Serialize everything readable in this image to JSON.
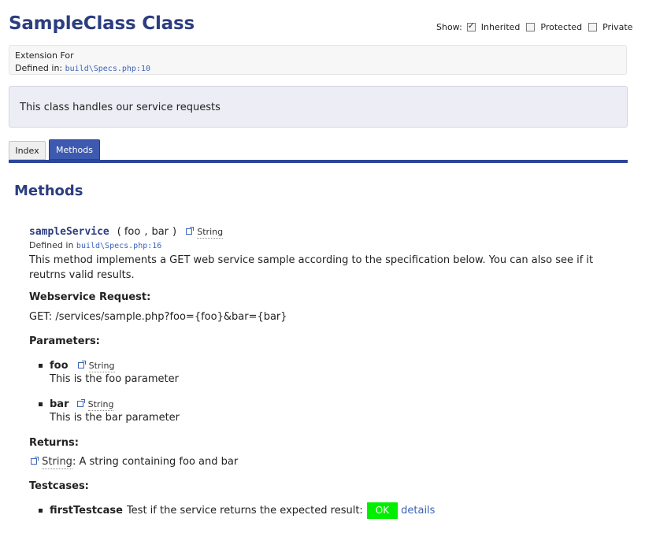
{
  "header": {
    "title": "SampleClass Class",
    "show_label": "Show:",
    "options": [
      {
        "label": "Inherited",
        "checked": true
      },
      {
        "label": "Protected",
        "checked": false
      },
      {
        "label": "Private",
        "checked": false
      }
    ]
  },
  "ext": {
    "line1": "Extension For",
    "defined_label": "Defined in:",
    "defined_path": "build\\Specs.php:10"
  },
  "description": "This class handles our service requests",
  "tabs": {
    "index": "Index",
    "methods": "Methods"
  },
  "section_title": "Methods",
  "method": {
    "name": "sampleService",
    "open": "(",
    "p1": "foo",
    "comma": ",",
    "p2": "bar",
    "close": ")",
    "return_type": "String",
    "defined_label": "Defined in",
    "defined_path": "build\\Specs.php:16",
    "desc_line1": "This method implements a GET web service sample according to the specification below. You can also see if it",
    "desc_line2": "reutrns valid results.",
    "ws_heading": "Webservice Request:",
    "ws_value": "GET: /services/sample.php?foo={foo}&bar={bar}",
    "params_heading": "Parameters:",
    "params": [
      {
        "name": "foo",
        "type": "String",
        "desc": "This is the foo parameter"
      },
      {
        "name": "bar",
        "type": "String",
        "desc": "This is the bar parameter"
      }
    ],
    "returns_heading": "Returns:",
    "returns_type": "String",
    "returns_desc": ": A string containing foo and bar",
    "testcases_heading": "Testcases:",
    "testcase": {
      "name": "firstTestcase",
      "desc": "Test if the service returns the expected result:",
      "status": "OK",
      "details": "details",
      "status_color": "#00ee00"
    }
  },
  "colors": {
    "title": "#2c3e7f",
    "link": "#3a63b8",
    "tab_active": "#3d5ab0"
  }
}
